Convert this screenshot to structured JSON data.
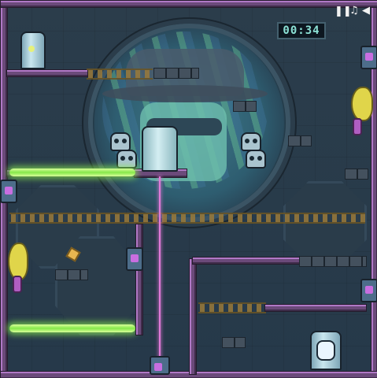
{
  "hud": {
    "timer": "00:34",
    "pause_icon": "pause-icon",
    "music_icon": "music-note-icon",
    "sound_icon": "speaker-icon"
  },
  "colors": {
    "pipe": "#6b4a7a",
    "laser_green": "#86e84a",
    "laser_pink": "#e07ad8",
    "background": "#26394a"
  }
}
